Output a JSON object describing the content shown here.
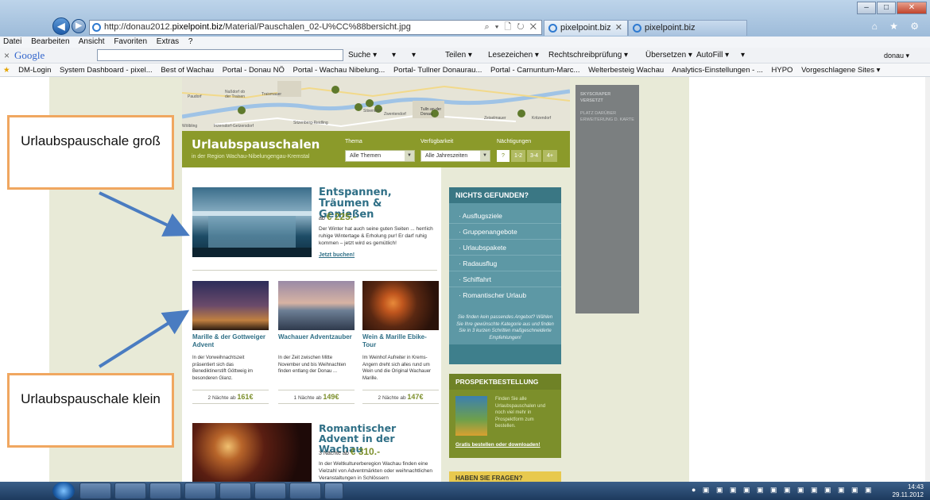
{
  "browser": {
    "url_prefix": "http://donau2012.",
    "url_domain": "pixelpoint.biz",
    "url_path": "/Material/Pauschalen_02-U%CC%88bersicht.jpg",
    "addr_icons": "⌕ ▾ 🗋 ↻ ✕",
    "tabs": [
      {
        "label": "pixelpoint.biz"
      },
      {
        "label": "pixelpoint.biz"
      }
    ],
    "top_icons": "⌂ ★ ⚙",
    "win_min": "–",
    "win_max": "□",
    "win_close": "✕",
    "back": "◀",
    "forward": "▶"
  },
  "menu": [
    "Datei",
    "Bearbeiten",
    "Ansicht",
    "Favoriten",
    "Extras",
    "?"
  ],
  "google_toolbar": {
    "close": "×",
    "logo": "Google",
    "items": [
      "Suche ▾",
      "▾",
      "▾",
      "Teilen ▾",
      "Lesezeichen ▾",
      "Rechtschreibprüfung ▾",
      "Übersetzen ▾",
      "AutoFill ▾",
      "▾"
    ],
    "user": "donau ▾"
  },
  "favorites": [
    "DM-Login",
    "System Dashboard - pixel...",
    "Best of Wachau",
    "Portal - Donau NÖ",
    "Portal - Wachau Nibelung...",
    "Portal- Tullner Donaurau...",
    "Portal - Carnuntum-Marc...",
    "Welterbesteig Wachau",
    "Analytics-Einstellungen - ...",
    "HYPO",
    "Vorgeschlagene Sites ▾"
  ],
  "map_labels": [
    "Paudorf",
    "Nußdorf ob der Traisen",
    "Traismauer",
    "Tulln an der Donau",
    "Stixendorf",
    "Zwentendorf",
    "Sitzenberg-Reidling",
    "Inzersdorf-Getzersdorf",
    "Zeiselmauer",
    "Kritzendorf",
    "Wölbling"
  ],
  "banner": {
    "title": "Urlaubspauschalen",
    "subtitle": "in der Region Wachau-Nibelungengau-Kremstal",
    "thema_label": "Thema",
    "thema_value": "Alle Themen",
    "verf_label": "Verfügbarkeit",
    "verf_value": "Alle Jahreszeiten",
    "naechte_label": "Nächtigungen",
    "naechte_opts": [
      "?",
      "1-2",
      "3-4",
      "4+"
    ],
    "select_arrow": "▼"
  },
  "featured": {
    "title": "Entspannen, Träumen & Genießen",
    "price_prefix": "ab",
    "price": "€ 225.-",
    "text": "Der Winter hat auch seine guten Seiten ... herrlich ruhige Wintertage & Erholung pur! Er darf ruhig kommen – jetzt wird es gemütlich!",
    "link": "Jetzt buchen!"
  },
  "small_items": [
    {
      "title": "Marille & der Gottweiger Advent",
      "text": "In der Vorweihnachtszeit präsentiert sich das Benediktinerstift Göttweig im besonderen Glanz.",
      "nights": "2 Nächte ab",
      "price": "161€"
    },
    {
      "title": "Wachauer Adventzauber",
      "text": "In der Zeit zwischen Mitte November und bis Weihnachten finden entlang der Donau ...",
      "nights": "1 Nächte ab",
      "price": "149€"
    },
    {
      "title": "Wein & Marille Ebike-Tour",
      "text": "Im Weinhof Aufreiter in Krems-Angern dreht sich alles rund um Wein und die Original Wachauer Marille.",
      "nights": "2 Nächte ab",
      "price": "147€"
    }
  ],
  "featured2": {
    "title": "Romantischer Advent in der Wachau",
    "price_prefix": "3 Nächte ab",
    "price": "€ 310.-",
    "text": "In der Weltkulturerberegion Wachau finden eine Vielzahl von Adventmärkten oder weihnachtlichen Veranstaltungen in Schlössern"
  },
  "sidebar": {
    "title": "NICHTS GEFUNDEN?",
    "links": [
      "Ausflugsziele",
      "Gruppenangebote",
      "Urlaubspakete",
      "Radausflug",
      "Schiffahrt",
      "Romantischer Urlaub"
    ],
    "text": "Sie finden kein passendes Angebot? Wählen Sie Ihre gewünschte Kategorie aus und finden Sie in 3 kurzen Schritten maßgeschneiderte Empfehlungen!"
  },
  "prospekt": {
    "title": "PROSPEKTBESTELLUNG",
    "text": "Finden Sie alle Urlaubspauschalen und noch viel mehr in Prospektform zum bestellen.",
    "link": "Gratis bestellen oder downloaden!"
  },
  "fragen": {
    "title": "HABEN SIE FRAGEN?"
  },
  "skyscraper": {
    "line1": "SKYSCRAPER",
    "line2": "VERSETZT",
    "line3": "PLATZ DARÜBER",
    "line4": "ERWEITERUNG D. KARTE"
  },
  "callouts": {
    "big": "Urlaubspauschale groß",
    "small": "Urlaubspauschale klein"
  },
  "clock": {
    "time": "14:43",
    "date": "29.11.2012"
  },
  "colors": {
    "olive": "#8b9a2a",
    "teal": "#3e7f8c",
    "green": "#7c8f2b",
    "orange": "#f0a760",
    "arrow": "#4a7cc1"
  }
}
